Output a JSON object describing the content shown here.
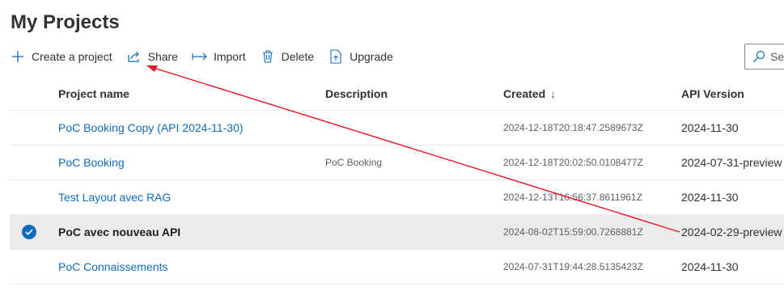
{
  "page": {
    "title": "My Projects"
  },
  "toolbar": {
    "create_label": "Create a project",
    "share_label": "Share",
    "import_label": "Import",
    "delete_label": "Delete",
    "upgrade_label": "Upgrade",
    "search_text": "Se"
  },
  "table": {
    "headers": {
      "name": "Project name",
      "description": "Description",
      "created": "Created",
      "created_sort": "↓",
      "api_version": "API Version"
    },
    "rows": [
      {
        "name": "PoC Booking Copy (API 2024-11-30)",
        "description": "",
        "created": "2024-12-18T20:18:47.2589673Z",
        "api_version": "2024-11-30",
        "selected": false
      },
      {
        "name": "PoC Booking",
        "description": "PoC Booking",
        "created": "2024-12-18T20:02:50.0108477Z",
        "api_version": "2024-07-31-preview",
        "selected": false
      },
      {
        "name": "Test Layout avec RAG",
        "description": "",
        "created": "2024-12-13T16:56:37.8611961Z",
        "api_version": "2024-11-30",
        "selected": false
      },
      {
        "name": "PoC avec nouveau API",
        "description": "",
        "created": "2024-08-02T15:59:00.7268881Z",
        "api_version": "2024-02-29-preview",
        "selected": true
      },
      {
        "name": "PoC Connaissements",
        "description": "",
        "created": "2024-07-31T19:44:28.5135423Z",
        "api_version": "2024-11-30",
        "selected": false
      }
    ]
  },
  "colors": {
    "accent": "#0f6cbd",
    "annotation_arrow": "#e81123",
    "selected_row": "#edebe9"
  }
}
